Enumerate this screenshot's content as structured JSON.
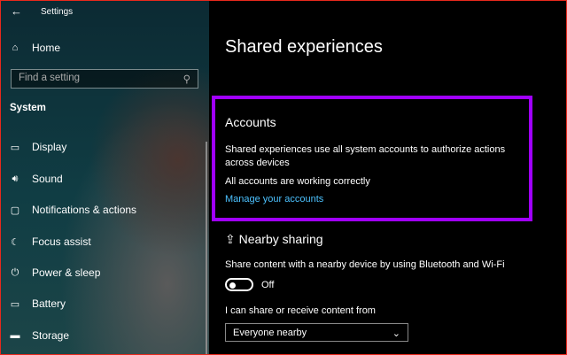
{
  "window": {
    "title": "Settings"
  },
  "sidebar": {
    "home": "Home",
    "search_placeholder": "Find a setting",
    "section": "System",
    "items": [
      {
        "label": "Display"
      },
      {
        "label": "Sound"
      },
      {
        "label": "Notifications & actions"
      },
      {
        "label": "Focus assist"
      },
      {
        "label": "Power & sleep"
      },
      {
        "label": "Battery"
      },
      {
        "label": "Storage"
      }
    ]
  },
  "main": {
    "title": "Shared experiences",
    "accounts": {
      "heading": "Accounts",
      "desc1": "Shared experiences use all system accounts to authorize actions",
      "desc2": "across devices",
      "status": "All accounts are working correctly",
      "link": "Manage your accounts"
    },
    "nearby": {
      "heading": "Nearby sharing",
      "desc": "Share content with a nearby device by using Bluetooth and Wi-Fi",
      "toggle_state": "Off",
      "from_label": "I can share or receive content from",
      "from_value": "Everyone nearby"
    }
  },
  "colors": {
    "highlight": "#a000ff",
    "link": "#4cc2ff"
  }
}
